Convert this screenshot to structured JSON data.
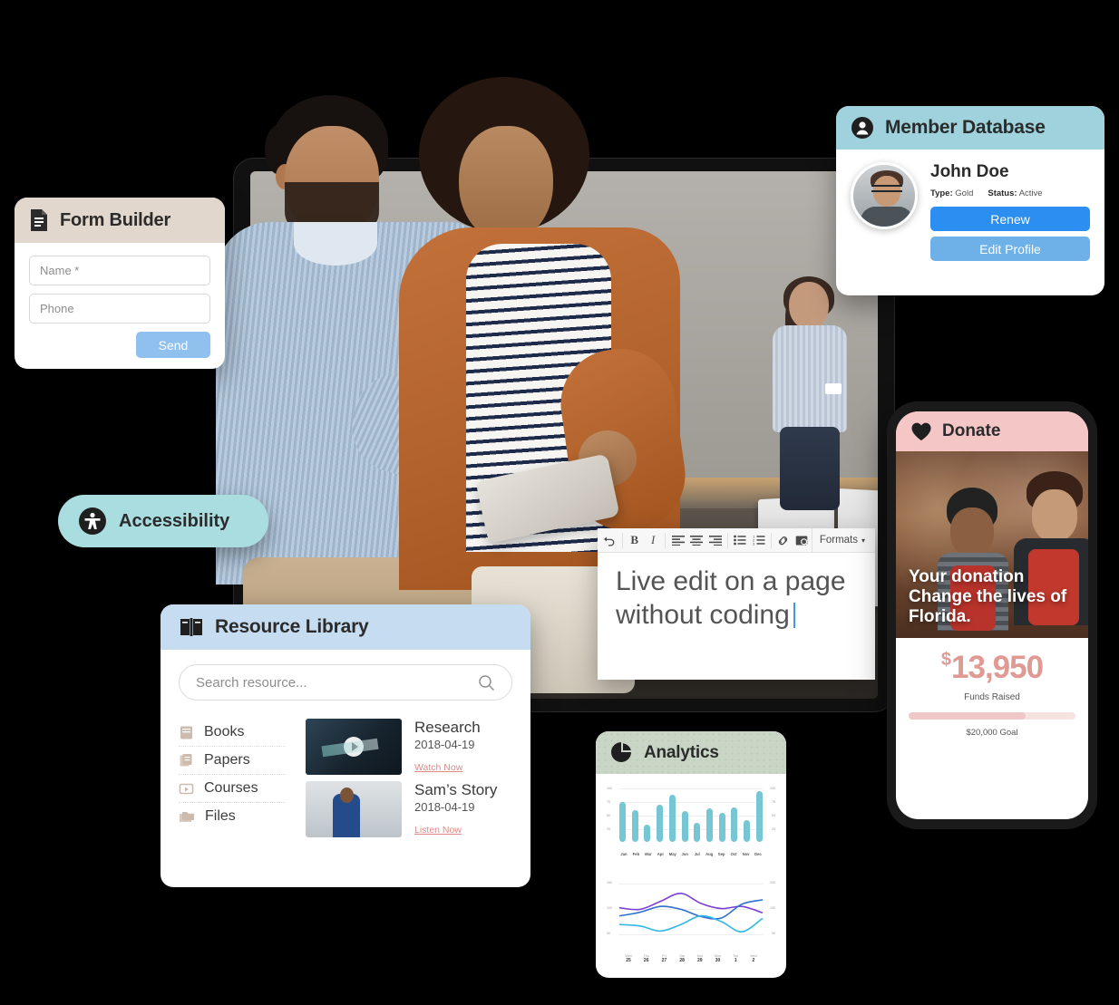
{
  "form_builder": {
    "title": "Form Builder",
    "icon": "document-icon",
    "header_color": "#E2D7CD",
    "fields": [
      {
        "name": "name",
        "placeholder": "Name *"
      },
      {
        "name": "phone",
        "placeholder": "Phone"
      }
    ],
    "send_label": "Send",
    "send_color": "#8FC0EE"
  },
  "member_database": {
    "title": "Member Database",
    "icon": "user-circle-icon",
    "header_color": "#9FD2DD",
    "member_name": "John Doe",
    "type_label": "Type:",
    "type_value": "Gold",
    "status_label": "Status:",
    "status_value": "Active",
    "renew_label": "Renew",
    "edit_label": "Edit Profile",
    "renew_color": "#2B8EF0",
    "edit_color": "#6EB0E8"
  },
  "accessibility": {
    "label": "Accessibility",
    "icon": "accessibility-icon",
    "color": "#A9DDE0"
  },
  "resource_library": {
    "title": "Resource Library",
    "icon": "open-book-icon",
    "header_color": "#C6DCF1",
    "search_placeholder": "Search resource...",
    "search_value": "",
    "nav": [
      {
        "label": "Books",
        "icon": "book-icon"
      },
      {
        "label": "Papers",
        "icon": "papers-icon"
      },
      {
        "label": "Courses",
        "icon": "video-icon"
      },
      {
        "label": "Files",
        "icon": "folders-icon"
      }
    ],
    "items": [
      {
        "title": "Research",
        "date": "2018-04-19",
        "link": "Watch Now",
        "media": "video"
      },
      {
        "title": "Sam’s Story",
        "date": "2018-04-19",
        "link": "Listen Now",
        "media": "audio"
      }
    ],
    "link_color": "#E08B86"
  },
  "editor": {
    "toolbar": [
      {
        "name": "undo",
        "glyph": "↶"
      },
      {
        "name": "bold",
        "glyph": "B"
      },
      {
        "name": "italic",
        "glyph": "I"
      },
      {
        "name": "align-left",
        "glyph": "≡"
      },
      {
        "name": "align-center",
        "glyph": "≡"
      },
      {
        "name": "align-right",
        "glyph": "≡"
      },
      {
        "name": "bullet-list",
        "glyph": "☰"
      },
      {
        "name": "numbered-list",
        "glyph": "☰"
      },
      {
        "name": "link",
        "glyph": "⚭"
      },
      {
        "name": "image",
        "glyph": "▣"
      }
    ],
    "formats_label": "Formats",
    "content": "Live edit on a page without coding"
  },
  "analytics": {
    "title": "Analytics",
    "icon": "pie-chart-icon",
    "header_color": "#C9D6C5"
  },
  "chart_data": [
    {
      "type": "bar",
      "title": "Analytics",
      "categories": [
        "Jan",
        "Feb",
        "Mar",
        "Apr",
        "May",
        "Jun",
        "Jul",
        "Aug",
        "Sep",
        "Oct",
        "Nov",
        "Dec"
      ],
      "values": [
        75,
        60,
        32,
        70,
        88,
        58,
        35,
        62,
        55,
        64,
        40,
        95
      ],
      "ylim": [
        0,
        100
      ],
      "yticks": [
        25,
        50,
        75,
        100
      ],
      "ytick_labels": [
        "25",
        "50",
        "75",
        "100"
      ],
      "color": "#76C6D4",
      "xlabel": "",
      "ylabel": "",
      "grid": true,
      "legend": "none"
    },
    {
      "type": "line",
      "title": "",
      "x": [
        "Wed 25",
        "Thu 26",
        "Fri 27",
        "Sat 28",
        "Sun 29",
        "Mon 30",
        "Tue 1",
        "Wed 2"
      ],
      "x_dow": [
        "Wed",
        "Thu",
        "Fri",
        "Sat",
        "Sun",
        "Mon",
        "Tue",
        "Wed"
      ],
      "x_day": [
        "25",
        "26",
        "27",
        "28",
        "29",
        "30",
        "1",
        "2"
      ],
      "yticks": [
        50,
        100,
        150
      ],
      "ytick_labels": [
        "50",
        "100",
        "150"
      ],
      "ylim": [
        20,
        165
      ],
      "grid": true,
      "legend": "none",
      "series": [
        {
          "name": "series-purple",
          "color": "#7B3FD4",
          "values": [
            108,
            104,
            126,
            148,
            120,
            106,
            112,
            95
          ]
        },
        {
          "name": "series-darkblue",
          "color": "#2F6FD0",
          "values": [
            86,
            96,
            112,
            104,
            84,
            80,
            118,
            130
          ]
        },
        {
          "name": "series-lightblue",
          "color": "#35B6E8",
          "values": [
            62,
            58,
            44,
            62,
            86,
            70,
            42,
            78
          ]
        }
      ]
    }
  ],
  "donate": {
    "title": "Donate",
    "icon": "heart-icon",
    "header_color": "#F4C6C6",
    "headline": "Your donation Change the lives of Florida.",
    "amount_symbol": "$",
    "amount": "13,950",
    "amount_label": "Funds Raised",
    "goal_label": "$20,000 Goal",
    "progress_percent": 70,
    "amount_color": "#E09A94",
    "bar_color": "#F0C7C7"
  }
}
